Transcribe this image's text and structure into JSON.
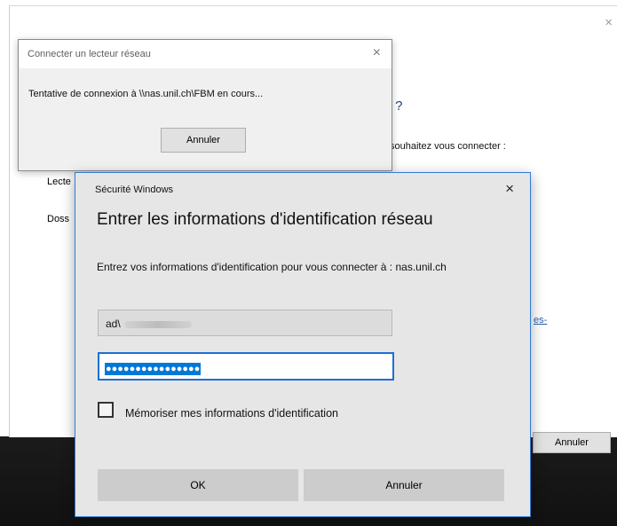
{
  "background_window": {
    "heading_fragment": "r ?",
    "question_fragment": "souhaitez vous connecter :",
    "drive_label_fragment": "Lecte",
    "folder_label_fragment": "Doss",
    "link_fragment": "es-",
    "cancel_label": "Annuler",
    "close_glyph": "×"
  },
  "connect_dialog": {
    "title": "Connecter un lecteur réseau",
    "message": "Tentative de connexion à \\\\nas.unil.ch\\FBM en cours...",
    "cancel_label": "Annuler",
    "close_glyph": "×"
  },
  "security_dialog": {
    "title": "Sécurité Windows",
    "heading": "Entrer les informations d'identification réseau",
    "instruction": "Entrez vos informations d'identification pour vous connecter à : nas.unil.ch",
    "username_value": "ad\\",
    "password_mask": "●●●●●●●●●●●●●●●●",
    "remember_label": "Mémoriser mes informations d'identification",
    "remember_checked": false,
    "ok_label": "OK",
    "cancel_label": "Annuler",
    "close_glyph": "×",
    "accent_color": "#0078d7"
  }
}
